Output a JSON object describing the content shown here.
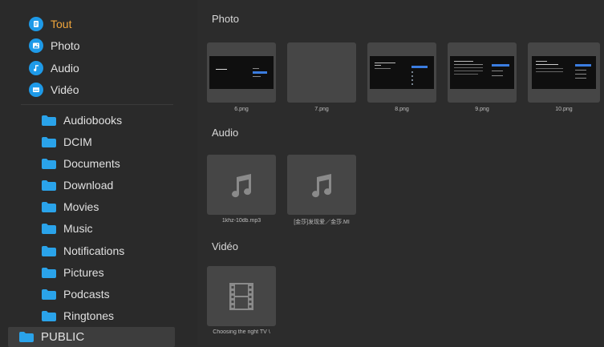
{
  "sidebar": {
    "categories": [
      {
        "label": "Tout",
        "icon": "document-icon",
        "active": true
      },
      {
        "label": "Photo",
        "icon": "image-icon",
        "active": false
      },
      {
        "label": "Audio",
        "icon": "music-note-icon",
        "active": false
      },
      {
        "label": "Vidéo",
        "icon": "video-icon",
        "active": false
      }
    ],
    "folders": [
      {
        "label": "Audiobooks"
      },
      {
        "label": "DCIM"
      },
      {
        "label": "Documents"
      },
      {
        "label": "Download"
      },
      {
        "label": "Movies"
      },
      {
        "label": "Music"
      },
      {
        "label": "Notifications"
      },
      {
        "label": "Pictures"
      },
      {
        "label": "Podcasts"
      },
      {
        "label": "Ringtones"
      },
      {
        "label": "PUBLIC",
        "selected": true
      }
    ]
  },
  "content": {
    "photo": {
      "title": "Photo",
      "items": [
        {
          "name": "6.png"
        },
        {
          "name": "7.png"
        },
        {
          "name": "8.png"
        },
        {
          "name": "9.png"
        },
        {
          "name": "10.png"
        }
      ]
    },
    "audio": {
      "title": "Audio",
      "items": [
        {
          "name": "1khz-10db.mp3"
        },
        {
          "name": "[金莎]发现爱／金莎.MI"
        }
      ]
    },
    "video": {
      "title": "Vidéo",
      "items": [
        {
          "name": "Choosing the right TV \\"
        }
      ]
    }
  },
  "colors": {
    "accent": "#f0a53c",
    "icon_blue": "#1e9ae8",
    "background": "#2b2b2b",
    "thumb_bg": "#464646"
  }
}
